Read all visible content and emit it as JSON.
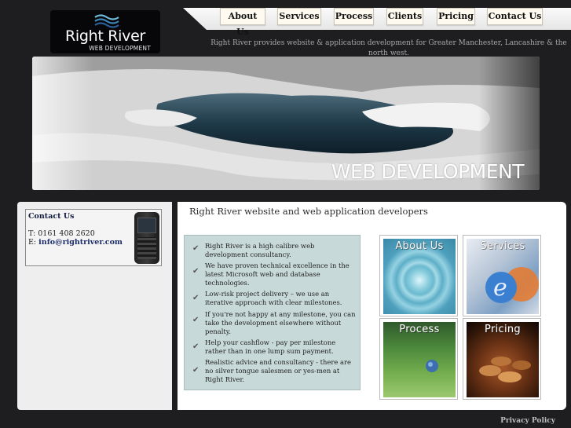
{
  "logo": {
    "name": "Right River",
    "subtitle": "WEB DEVELOPMENT"
  },
  "nav": {
    "items": [
      {
        "label": "About Us"
      },
      {
        "label": "Services"
      },
      {
        "label": "Process"
      },
      {
        "label": "Clients"
      },
      {
        "label": "Pricing"
      },
      {
        "label": "Contact Us"
      }
    ]
  },
  "tagline": "Right River provides website & application development for Greater Manchester, Lancashire & the north west.",
  "banner": {
    "text": "WEB DEVELOPMENT"
  },
  "contact": {
    "title": "Contact Us",
    "phone_prefix": "T:",
    "phone": "0161 408 2620",
    "email_prefix": "E:",
    "email": "info@rightriver.com"
  },
  "main": {
    "title": "Right River website and web application developers",
    "features": [
      "Right River is a high calibre web development consultancy.",
      "We have proven technical excellence in the latest Microsoft web and database technologies.",
      "Low-risk project delivery – we use an iterative approach with clear milestones.",
      "If you're not happy at any milestone, you can take the development elsewhere without penalty.",
      "Help your cashflow - pay per milestone rather than in one lump sum payment.",
      "Realistic advice and consultancy - there are no silver tongue salesmen or yes-men at Right River."
    ],
    "tiles": [
      {
        "label": "About Us"
      },
      {
        "label": "Services"
      },
      {
        "label": "Process"
      },
      {
        "label": "Pricing"
      }
    ]
  },
  "footer": {
    "privacy": "Privacy Policy"
  },
  "colors": {
    "page_background": "#1e1d1f",
    "nav_button_background": "#fffaf0",
    "features_panel": "#c8d9d9",
    "link": "#1b2c68"
  }
}
